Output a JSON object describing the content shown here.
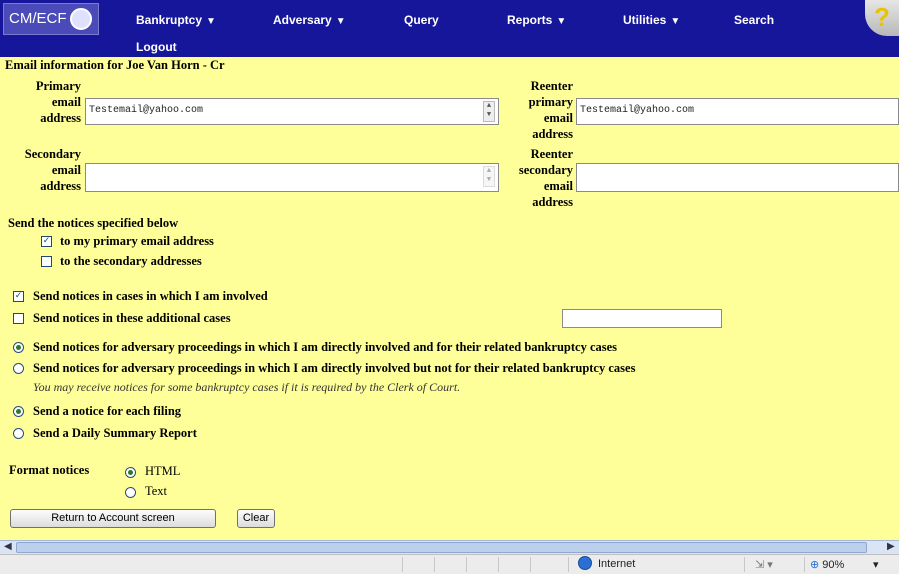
{
  "menu": {
    "logo": "CM/ECF",
    "items": [
      {
        "label": "Bankruptcy",
        "dropdown": true
      },
      {
        "label": "Adversary",
        "dropdown": true
      },
      {
        "label": "Query",
        "dropdown": false
      },
      {
        "label": "Reports",
        "dropdown": true
      },
      {
        "label": "Utilities",
        "dropdown": true
      },
      {
        "label": "Search",
        "dropdown": false
      },
      {
        "label": "Logout",
        "dropdown": false
      }
    ],
    "help": "?"
  },
  "page_heading": "Email information for Joe Van Horn - Cr",
  "primary": {
    "label_lines": [
      "Primary",
      "email",
      "address"
    ],
    "value": "Testemail@yahoo.com",
    "reenter_label_lines": [
      "Reenter",
      "primary",
      "email",
      "address"
    ],
    "reenter_value": "Testemail@yahoo.com"
  },
  "secondary": {
    "label_lines": [
      "Secondary",
      "email",
      "address"
    ],
    "value": "",
    "reenter_label_lines": [
      "Reenter",
      "secondary",
      "email",
      "address"
    ],
    "reenter_value": ""
  },
  "notices": {
    "heading": "Send the notices specified below",
    "to_primary": "to my primary email address",
    "to_primary_checked": true,
    "to_secondary": "to the secondary addresses",
    "to_secondary_checked": false
  },
  "cases": {
    "involved": "Send notices in cases in which I am involved",
    "involved_checked": true,
    "additional": "Send notices in these additional cases",
    "additional_checked": false,
    "additional_value": ""
  },
  "adversary": {
    "option1": "Send notices for adversary proceedings in which I am directly involved and for their related bankruptcy cases",
    "option2": "Send notices for adversary proceedings in which I am directly involved but not for their related bankruptcy cases",
    "selected": "option1",
    "note": "You may receive notices for some bankruptcy cases if it is required by the Clerk of Court."
  },
  "frequency": {
    "each": "Send a notice for each filing",
    "summary": "Send a Daily Summary Report",
    "selected": "each"
  },
  "format": {
    "label": "Format notices",
    "html": "HTML",
    "text": "Text",
    "selected": "html"
  },
  "buttons": {
    "return": "Return to Account screen",
    "clear": "Clear"
  },
  "status": {
    "zone": "Internet",
    "zoom": "90%"
  },
  "colors": {
    "menu_bg": "#16169a",
    "page_bg": "#ffff99"
  },
  "icons": [
    "logo-icon",
    "help-icon",
    "checkmark-icon",
    "globe-icon",
    "zoom-icon",
    "scroll-left-icon",
    "scroll-right-icon"
  ]
}
